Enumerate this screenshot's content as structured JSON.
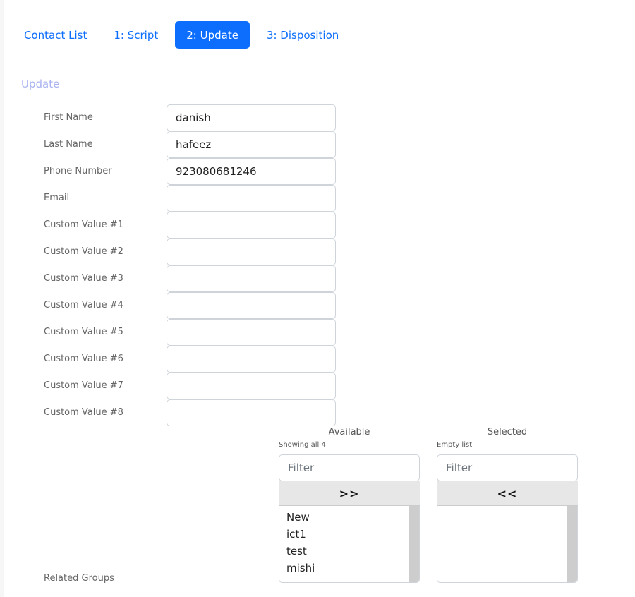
{
  "tabs": [
    {
      "label": "Contact List",
      "active": false
    },
    {
      "label": "1: Script",
      "active": false
    },
    {
      "label": "2: Update",
      "active": true
    },
    {
      "label": "3: Disposition",
      "active": false
    }
  ],
  "section_title": "Update",
  "fields": [
    {
      "label": "First Name",
      "value": "danish"
    },
    {
      "label": "Last Name",
      "value": "hafeez"
    },
    {
      "label": "Phone Number",
      "value": "923080681246"
    },
    {
      "label": "Email",
      "value": ""
    },
    {
      "label": "Custom Value #1",
      "value": ""
    },
    {
      "label": "Custom Value #2",
      "value": ""
    },
    {
      "label": "Custom Value #3",
      "value": ""
    },
    {
      "label": "Custom Value #4",
      "value": ""
    },
    {
      "label": "Custom Value #5",
      "value": ""
    },
    {
      "label": "Custom Value #6",
      "value": ""
    },
    {
      "label": "Custom Value #7",
      "value": ""
    },
    {
      "label": "Custom Value #8",
      "value": ""
    }
  ],
  "related_groups": {
    "label": "Related Groups",
    "available": {
      "title": "Available",
      "info": "Showing all 4",
      "filter_placeholder": "Filter",
      "move_all_label": ">>",
      "items": [
        "New",
        "ict1",
        "test",
        "mishi"
      ]
    },
    "selected": {
      "title": "Selected",
      "info": "Empty list",
      "filter_placeholder": "Filter",
      "remove_all_label": "<<",
      "items": []
    }
  },
  "colors": {
    "accent": "#0d6efd",
    "section_title": "#a9b3f0"
  }
}
